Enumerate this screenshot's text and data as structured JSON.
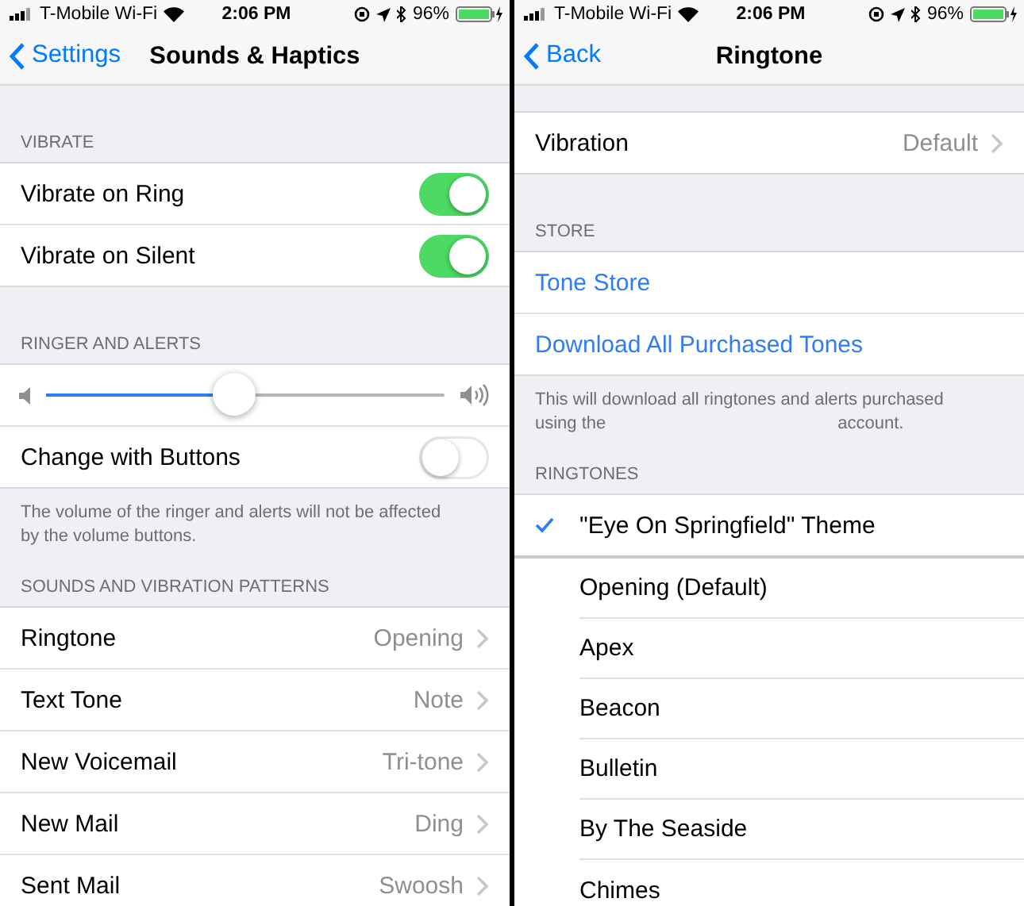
{
  "panes": [
    {
      "status_bar": {
        "carrier": "T-Mobile Wi-Fi",
        "time": "2:06 PM",
        "battery": "96%"
      },
      "nav": {
        "back": "Settings",
        "title": "Sounds & Haptics"
      },
      "sections": [
        {
          "header": "VIBRATE",
          "rows": [
            {
              "kind": "toggle",
              "label": "Vibrate on Ring",
              "on": true
            },
            {
              "kind": "toggle",
              "label": "Vibrate on Silent",
              "on": true
            }
          ]
        },
        {
          "header": "RINGER AND ALERTS",
          "rows": [
            {
              "kind": "slider",
              "level": 0.47
            },
            {
              "kind": "toggle",
              "label": "Change with Buttons",
              "on": false
            }
          ],
          "footer": [
            [
              "The volume of the ringer and alerts will not be affected by the volume buttons."
            ]
          ]
        },
        {
          "header": "SOUNDS AND VIBRATION PATTERNS",
          "rows": [
            {
              "kind": "disclosure",
              "label": "Ringtone",
              "value": "Opening"
            },
            {
              "kind": "disclosure",
              "label": "Text Tone",
              "value": "Note"
            },
            {
              "kind": "disclosure",
              "label": "New Voicemail",
              "value": "Tri-tone"
            },
            {
              "kind": "disclosure",
              "label": "New Mail",
              "value": "Ding"
            },
            {
              "kind": "disclosure",
              "label": "Sent Mail",
              "value": "Swoosh"
            }
          ]
        }
      ]
    },
    {
      "status_bar": {
        "carrier": "T-Mobile Wi-Fi",
        "time": "2:06 PM",
        "battery": "96%"
      },
      "nav": {
        "back": "Back",
        "title": "Ringtone"
      },
      "sections": [
        {
          "rows": [
            {
              "kind": "disclosure",
              "label": "Vibration",
              "value": "Default"
            }
          ]
        },
        {
          "header": "STORE",
          "rows": [
            {
              "kind": "link",
              "label": "Tone Store"
            },
            {
              "kind": "link",
              "label": "Download All Purchased Tones"
            }
          ],
          "footer": [
            [
              "This will download all ringtones and alerts purchased"
            ],
            [
              "using the",
              "account."
            ]
          ]
        },
        {
          "header": "RINGTONES",
          "rows": [
            {
              "kind": "tone",
              "label": "\"Eye On Springfield\" Theme",
              "selected": true
            },
            {
              "kind": "tone",
              "label": "Opening (Default)",
              "selected": false
            },
            {
              "kind": "tone",
              "label": "Apex",
              "selected": false
            },
            {
              "kind": "tone",
              "label": "Beacon",
              "selected": false
            },
            {
              "kind": "tone",
              "label": "Bulletin",
              "selected": false
            },
            {
              "kind": "tone",
              "label": "By The Seaside",
              "selected": false
            },
            {
              "kind": "tone",
              "label": "Chimes",
              "selected": false
            }
          ]
        }
      ]
    }
  ]
}
